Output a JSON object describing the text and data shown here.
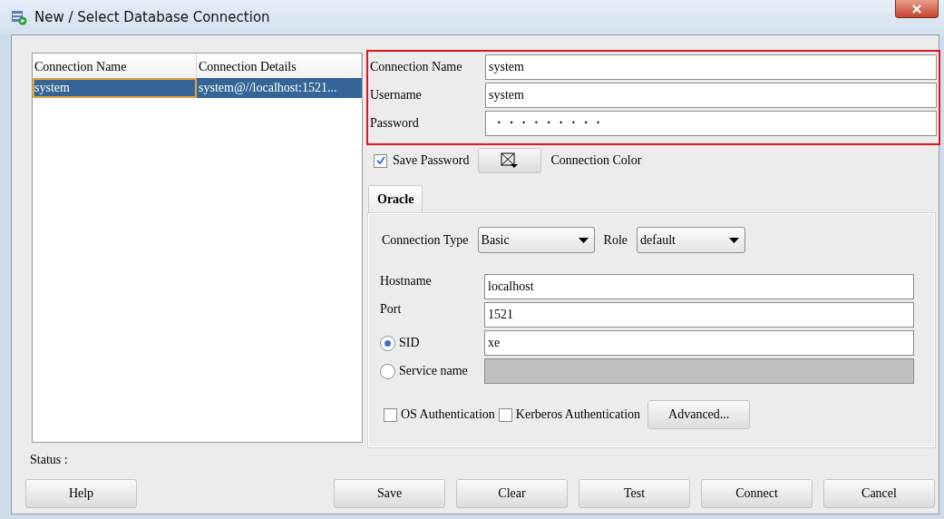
{
  "window": {
    "title": "New / Select Database Connection"
  },
  "connections": {
    "columns": [
      "Connection Name",
      "Connection Details"
    ],
    "rows": [
      {
        "cells": [
          "system",
          "system@//localhost:1521..."
        ],
        "selected": true
      }
    ]
  },
  "credentials": {
    "highlighted": true,
    "fields": [
      {
        "label": "Connection Name",
        "value": "system",
        "kind": "text"
      },
      {
        "label": "Username",
        "value": "system",
        "kind": "text"
      },
      {
        "label": "Password",
        "value": "·········",
        "kind": "password"
      }
    ]
  },
  "save_password": {
    "label": "Save Password",
    "checked": true
  },
  "connection_color": {
    "label": "Connection Color"
  },
  "tabs": [
    {
      "label": "Oracle",
      "selected": true
    }
  ],
  "selects": [
    {
      "label": "Connection Type",
      "value": "Basic"
    },
    {
      "label": "Role",
      "value": "default"
    }
  ],
  "fields": [
    {
      "label": "Hostname",
      "value": "localhost",
      "kind": "text"
    },
    {
      "label": "Port",
      "value": "1521",
      "kind": "text"
    },
    {
      "label": "SID",
      "value": "xe",
      "kind": "radio",
      "selected": true,
      "disabled": false
    },
    {
      "label": "Service name",
      "kind": "radio",
      "selected": false,
      "disabled": true
    }
  ],
  "auth": [
    {
      "label": "OS Authentication",
      "checked": false
    },
    {
      "label": "Kerberos Authentication",
      "checked": false
    }
  ],
  "advanced_button": "Advanced...",
  "status": "Status :",
  "buttons": [
    "Help",
    "Save",
    "Clear",
    "Test",
    "Connect",
    "Cancel"
  ]
}
